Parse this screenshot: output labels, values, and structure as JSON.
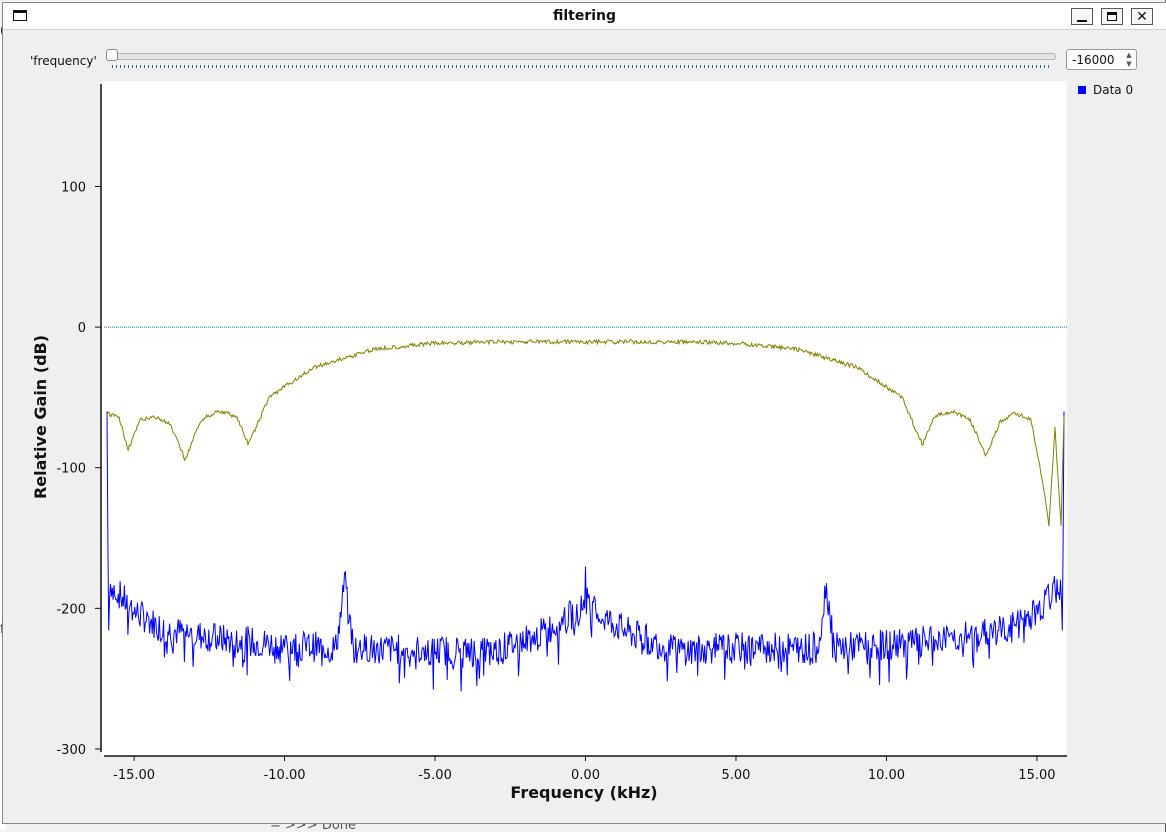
{
  "window": {
    "title": "filtering",
    "controls": [
      "minimize",
      "maximize",
      "close"
    ]
  },
  "background": {
    "left_chars": [
      "u",
      "f"
    ],
    "bottom_text": "= >>> Done"
  },
  "control": {
    "label": "'frequency'",
    "spin_value": "-16000",
    "slider_fraction": 0
  },
  "legend": {
    "entries": [
      {
        "label": "Data 0",
        "color": "#0000ff"
      }
    ]
  },
  "colors": {
    "data0": "#0000ff",
    "taps": "#808000",
    "zero_line": "#008080"
  },
  "chart_data": {
    "type": "line",
    "xlabel": "Frequency (kHz)",
    "ylabel": "Relative Gain (dB)",
    "xlim": [
      -16.0,
      16.0
    ],
    "ylim": [
      -305,
      175
    ],
    "xticks": [
      "-15.00",
      "-10.00",
      "-5.00",
      "0.00",
      "5.00",
      "10.00",
      "15.00"
    ],
    "yticks": [
      "100",
      "0",
      "-100",
      "-200",
      "-300"
    ],
    "series": [
      {
        "name": "Data 0",
        "color": "#0000ff",
        "noise_floor_db": -228,
        "x": [
          -15.9,
          -15.85,
          -15.8,
          -15.5,
          -15,
          -14,
          -12,
          -10,
          -8.3,
          -8.1,
          -8.0,
          -7.9,
          -7.7,
          -5,
          -3,
          -1.5,
          -0.1,
          0.0,
          0.1,
          1.5,
          3,
          5,
          7.7,
          7.9,
          8.0,
          8.1,
          8.3,
          10,
          12,
          14,
          15,
          15.5,
          15.8,
          15.85,
          15.9
        ],
        "y": [
          -60,
          -222,
          -182,
          -190,
          -202,
          -215,
          -222,
          -226,
          -228,
          -200,
          -178,
          -200,
          -228,
          -230,
          -230,
          -218,
          -200,
          -175,
          -200,
          -218,
          -230,
          -228,
          -228,
          -200,
          -183,
          -200,
          -228,
          -226,
          -222,
          -215,
          -202,
          -190,
          -182,
          -222,
          -60
        ]
      },
      {
        "color": "#808000",
        "x": [
          -15.9,
          -15.5,
          -15.2,
          -14.8,
          -14.3,
          -13.8,
          -13.3,
          -12.8,
          -12.2,
          -11.6,
          -11.2,
          -10.5,
          -9,
          -7,
          -5,
          -3,
          -1,
          0,
          1,
          3,
          5,
          7,
          9,
          10.5,
          11.2,
          11.6,
          12.2,
          12.8,
          13.3,
          13.8,
          14.3,
          14.8,
          15.2,
          15.4,
          15.6,
          15.8,
          15.9
        ],
        "y": [
          -60,
          -63,
          -85,
          -65,
          -62,
          -68,
          -93,
          -65,
          -58,
          -62,
          -82,
          -48,
          -27,
          -14,
          -10,
          -9,
          -9,
          -9,
          -9,
          -9,
          -10,
          -14,
          -27,
          -48,
          -82,
          -62,
          -58,
          -65,
          -90,
          -65,
          -60,
          -64,
          -110,
          -140,
          -70,
          -140,
          -62
        ]
      },
      {
        "color": "#008080",
        "x": [
          -16.0,
          16.0
        ],
        "y": [
          0,
          0
        ]
      }
    ]
  }
}
